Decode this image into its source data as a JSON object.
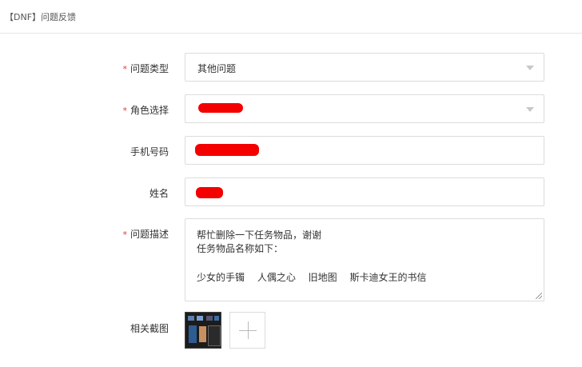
{
  "header": {
    "title": "【DNF】问题反馈"
  },
  "form": {
    "required_mark": "*",
    "type": {
      "label": "问题类型",
      "value": "其他问题"
    },
    "role": {
      "label": "角色选择"
    },
    "phone": {
      "label": "手机号码"
    },
    "name": {
      "label": "姓名"
    },
    "description": {
      "label": "问题描述",
      "lines": [
        "帮忙删除一下任务物品，谢谢",
        "任务物品名称如下：",
        "少女的手镯　 人偶之心　 旧地图　 斯卡迪女王的书信"
      ]
    },
    "screenshot": {
      "label": "相关截图"
    }
  },
  "colors": {
    "required": "#e53935",
    "redaction": "#f40000",
    "border": "#dcdcdc"
  }
}
